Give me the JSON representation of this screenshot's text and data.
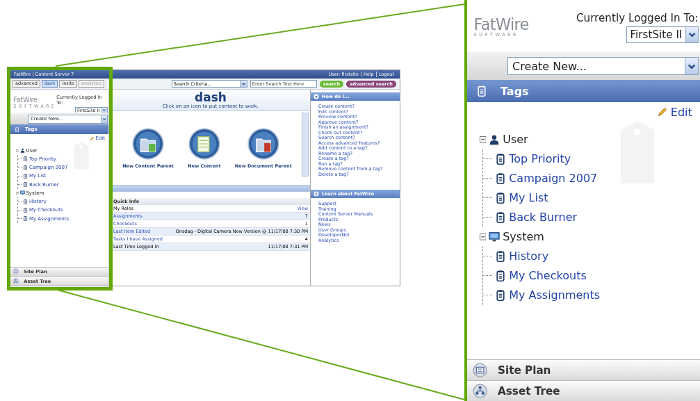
{
  "thumbnail": {
    "header": {
      "title": "FatWire | Content Server 7",
      "user": "User: firstsite",
      "links": [
        "Help",
        "Logout"
      ]
    },
    "tabs": [
      {
        "label": "advanced",
        "selected": false,
        "disabled": false
      },
      {
        "label": "dash",
        "selected": true,
        "disabled": false
      },
      {
        "label": "insite",
        "selected": false,
        "disabled": false
      },
      {
        "label": "analytics",
        "selected": false,
        "disabled": true
      }
    ],
    "search": {
      "criteria": "Search Criteria...",
      "placeholder": "Enter Search Text Here",
      "buttons": [
        {
          "label": "search",
          "color": "#66bb33"
        },
        {
          "label": "advanced search",
          "color": "#884477"
        }
      ]
    },
    "left_panel": {
      "logo": "FatWire",
      "logo_sub": "SOFTWARE",
      "logged_in_label": "Currently Logged In To:",
      "site": "FirstSite II",
      "create_new": "Create New...",
      "section_title": "Tags",
      "edit": "Edit",
      "tree": [
        {
          "label": "User",
          "kind": "user",
          "expanded": true,
          "children": [
            {
              "label": "Top Priority"
            },
            {
              "label": "Campaign 2007"
            },
            {
              "label": "My List"
            },
            {
              "label": "Back Burner"
            }
          ]
        },
        {
          "label": "System",
          "kind": "system",
          "expanded": true,
          "children": [
            {
              "label": "History"
            },
            {
              "label": "My Checkouts"
            },
            {
              "label": "My Assignments"
            }
          ]
        }
      ],
      "panels": [
        {
          "label": "Site Plan",
          "kind": "site-plan"
        },
        {
          "label": "Asset Tree",
          "kind": "asset-tree"
        }
      ]
    },
    "dash": {
      "title": "dash",
      "subtitle": "Click on an icon to put content to work.",
      "icons": [
        {
          "label": "New Content Parent",
          "kind": "folder"
        },
        {
          "label": "New Content",
          "kind": "document"
        },
        {
          "label": "New Document Parent",
          "kind": "folder-document"
        }
      ]
    },
    "quick_info": {
      "title": "Quick Info",
      "rows": [
        {
          "label": "My Roles",
          "link": false,
          "value": "View",
          "value_link": true
        },
        {
          "label": "Assignments",
          "link": true,
          "value": "7",
          "value_link": false
        },
        {
          "label": "Checkouts",
          "link": true,
          "value": "1",
          "value_link": false
        },
        {
          "label": "Last Item Edited",
          "link": true,
          "value": "Onsdag - Digital Camera New Version @ 11/17/08 7:30 PM",
          "value_link": false
        },
        {
          "label": "Tasks I have Assigned",
          "link": true,
          "value": "4",
          "value_link": false
        },
        {
          "label": "Last Time Logged In",
          "link": false,
          "value": "11/17/08 7:31 PM",
          "value_link": false
        }
      ]
    },
    "how_do_i": {
      "title": "How do I...",
      "links": [
        "Create content?",
        "Edit content?",
        "Preview content?",
        "Approve content?",
        "Finish an assignment?",
        "Check out content?",
        "Search content?",
        "Access advanced features?",
        "Add content to a tag?",
        "Rename a tag?",
        "Create a tag?",
        "Run a tag?",
        "Remove content from a tag?",
        "Delete a tag?"
      ]
    },
    "learn": {
      "title": "Learn about FatWire",
      "links": [
        "Support",
        "Training",
        "Content Server Manuals",
        "Products",
        "News",
        "User Groups",
        "DeveloperNet",
        "Analytics"
      ]
    }
  },
  "magnified": {
    "left_panel": {
      "logo": "FatWire",
      "logo_sub": "SOFTWARE",
      "logged_in_label": "Currently Logged In To:",
      "site": "FirstSite II",
      "create_new": "Create New...",
      "section_title": "Tags",
      "edit": "Edit",
      "tree": [
        {
          "label": "User",
          "kind": "user",
          "expanded": true,
          "children": [
            {
              "label": "Top Priority"
            },
            {
              "label": "Campaign 2007"
            },
            {
              "label": "My List"
            },
            {
              "label": "Back Burner"
            }
          ]
        },
        {
          "label": "System",
          "kind": "system",
          "expanded": true,
          "children": [
            {
              "label": "History"
            },
            {
              "label": "My Checkouts"
            },
            {
              "label": "My Assignments"
            }
          ]
        }
      ],
      "panels": [
        {
          "label": "Site Plan",
          "kind": "site-plan"
        },
        {
          "label": "Asset Tree",
          "kind": "asset-tree"
        }
      ]
    }
  }
}
